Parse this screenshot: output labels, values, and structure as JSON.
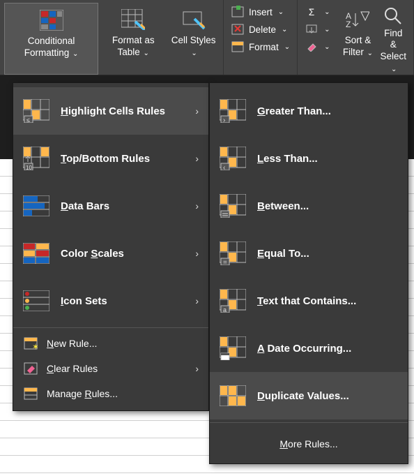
{
  "ribbon": {
    "conditional_formatting": "Conditional Formatting",
    "format_as_table": "Format as Table",
    "cell_styles": "Cell Styles",
    "insert": "Insert",
    "delete": "Delete",
    "format": "Format",
    "sort_filter": "Sort & Filter",
    "find_select": "Find & Select"
  },
  "menu1": {
    "highlight": "Highlight Cells Rules",
    "topbottom": "Top/Bottom Rules",
    "databars": "Data Bars",
    "colorscales": "Color Scales",
    "iconsets": "Icon Sets",
    "newrule": "New Rule...",
    "clear": "Clear Rules",
    "manage": "Manage Rules..."
  },
  "menu2": {
    "greater": "Greater Than...",
    "less": "Less Than...",
    "between": "Between...",
    "equal": "Equal To...",
    "textcontains": "Text that Contains...",
    "dateoccur": "A Date Occurring...",
    "duplicate": "Duplicate Values...",
    "more": "More Rules..."
  }
}
